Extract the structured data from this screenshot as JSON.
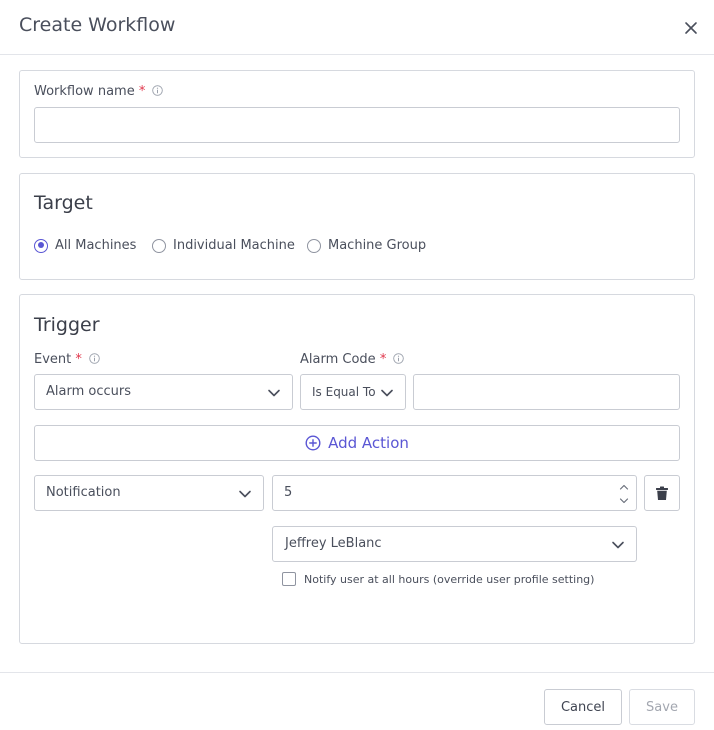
{
  "modal": {
    "title": "Create Workflow"
  },
  "workflow_name": {
    "label": "Workflow name",
    "required_mark": "*",
    "value": ""
  },
  "target": {
    "title": "Target",
    "options": [
      {
        "label": "All Machines",
        "checked": true
      },
      {
        "label": "Individual Machine",
        "checked": false
      },
      {
        "label": "Machine Group",
        "checked": false
      }
    ]
  },
  "trigger": {
    "title": "Trigger",
    "event": {
      "label": "Event",
      "required_mark": "*",
      "value": "Alarm occurs"
    },
    "alarm_code": {
      "label": "Alarm Code",
      "required_mark": "*",
      "operator": "Is Equal To",
      "value": ""
    },
    "add_action_label": "Add Action",
    "action": {
      "type": "Notification",
      "number_value": "5",
      "user": "Jeffrey LeBlanc",
      "checkbox_label": "Notify user at all hours (override user profile setting)",
      "checkbox_checked": false
    }
  },
  "footer": {
    "cancel_label": "Cancel",
    "save_label": "Save"
  },
  "colors": {
    "accent": "#5a56d4",
    "required": "#e0364b",
    "border": "#c9ccd3"
  },
  "icons": [
    "close-icon",
    "info-icon",
    "chevron-down-icon",
    "plus-circle-icon",
    "spinner-arrows-icon",
    "trash-icon"
  ]
}
